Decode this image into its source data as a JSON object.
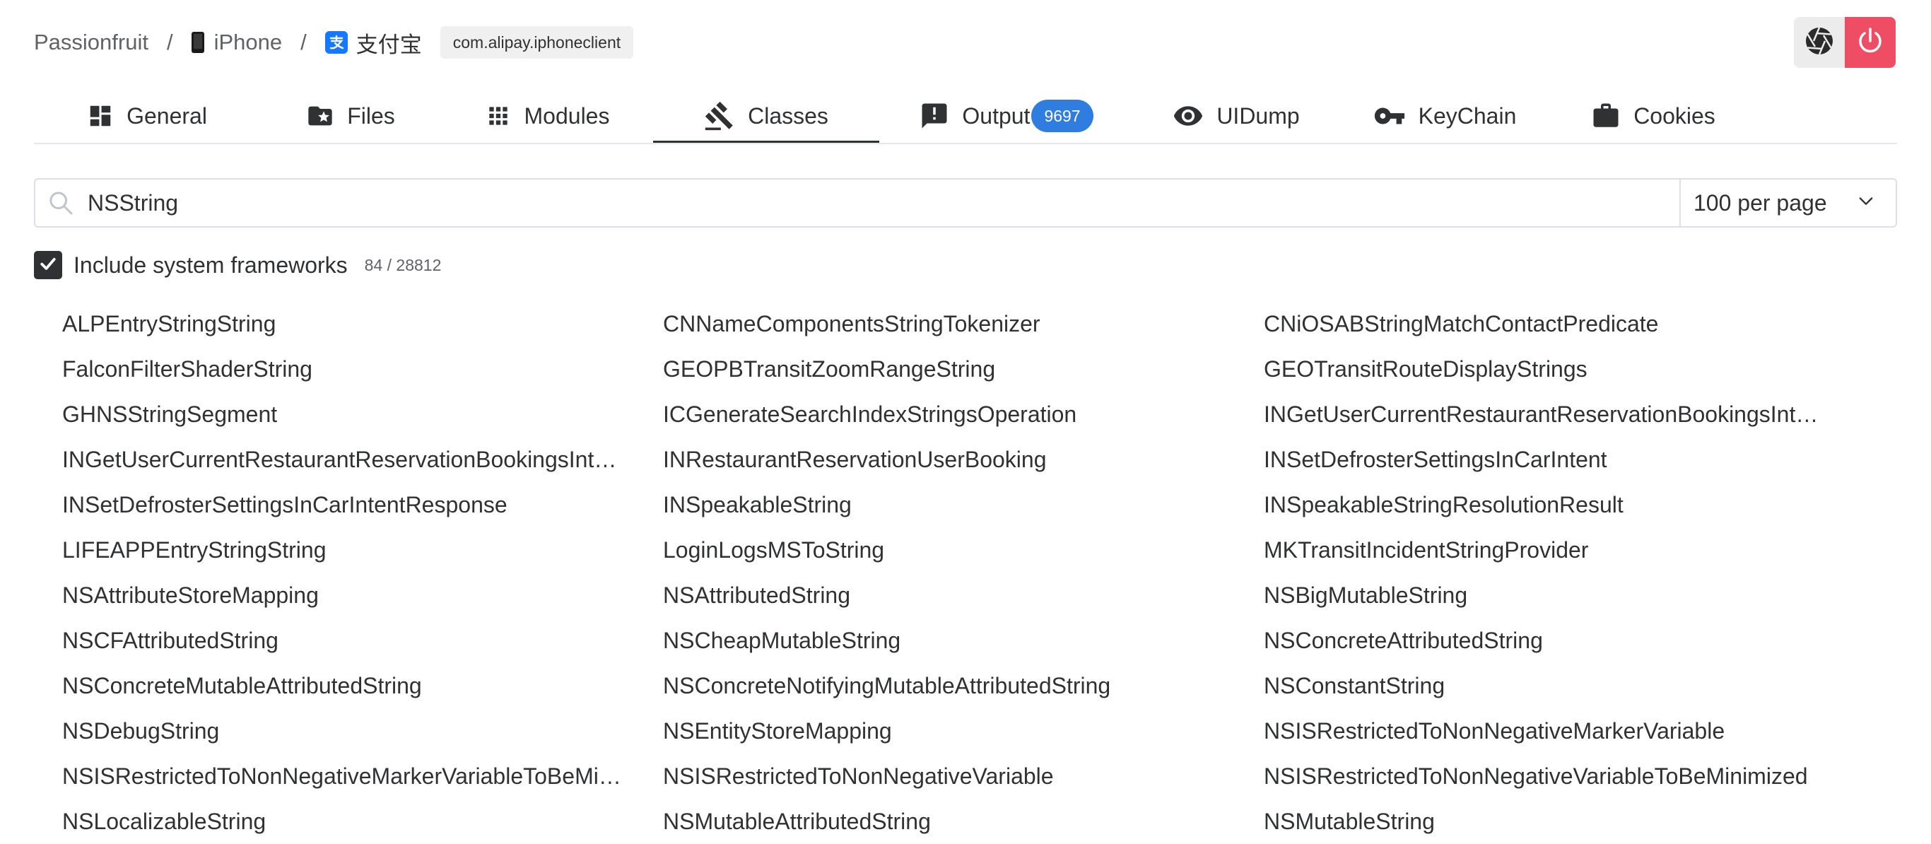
{
  "breadcrumb": {
    "root": "Passionfruit",
    "separator": "/",
    "device": "iPhone",
    "app": "支付宝",
    "bundle_id": "com.alipay.iphoneclient"
  },
  "tabs": [
    {
      "label": "General",
      "icon": "dashboard-icon"
    },
    {
      "label": "Files",
      "icon": "folder-star-icon"
    },
    {
      "label": "Modules",
      "icon": "grid-icon"
    },
    {
      "label": "Classes",
      "icon": "gavel-icon",
      "active": true
    },
    {
      "label": "Output",
      "icon": "alert-box-icon",
      "badge": "9697"
    },
    {
      "label": "UIDump",
      "icon": "eye-icon"
    },
    {
      "label": "KeyChain",
      "icon": "key-icon"
    },
    {
      "label": "Cookies",
      "icon": "briefcase-icon"
    }
  ],
  "search": {
    "value": "NSString",
    "per_page": "100 per page"
  },
  "options": {
    "include_system_label": "Include system frameworks",
    "include_system_checked": true,
    "count": "84 / 28812"
  },
  "classes": [
    "ALPEntryStringString",
    "CNNameComponentsStringTokenizer",
    "CNiOSABStringMatchContactPredicate",
    "FalconFilterShaderString",
    "GEOPBTransitZoomRangeString",
    "GEOTransitRouteDisplayStrings",
    "GHNSStringSegment",
    "ICGenerateSearchIndexStringsOperation",
    "INGetUserCurrentRestaurantReservationBookingsInt…",
    "INGetUserCurrentRestaurantReservationBookingsInt…",
    "INRestaurantReservationUserBooking",
    "INSetDefrosterSettingsInCarIntent",
    "INSetDefrosterSettingsInCarIntentResponse",
    "INSpeakableString",
    "INSpeakableStringResolutionResult",
    "LIFEAPPEntryStringString",
    "LoginLogsMSToString",
    "MKTransitIncidentStringProvider",
    "NSAttributeStoreMapping",
    "NSAttributedString",
    "NSBigMutableString",
    "NSCFAttributedString",
    "NSCheapMutableString",
    "NSConcreteAttributedString",
    "NSConcreteMutableAttributedString",
    "NSConcreteNotifyingMutableAttributedString",
    "NSConstantString",
    "NSDebugString",
    "NSEntityStoreMapping",
    "NSISRestrictedToNonNegativeMarkerVariable",
    "NSISRestrictedToNonNegativeMarkerVariableToBeMi…",
    "NSISRestrictedToNonNegativeVariable",
    "NSISRestrictedToNonNegativeVariableToBeMinimized",
    "NSLocalizableString",
    "NSMutableAttributedString",
    "NSMutableString"
  ],
  "colors": {
    "accent_badge": "#2f7de1",
    "power_button": "#ee4d64",
    "text": "#303133"
  }
}
